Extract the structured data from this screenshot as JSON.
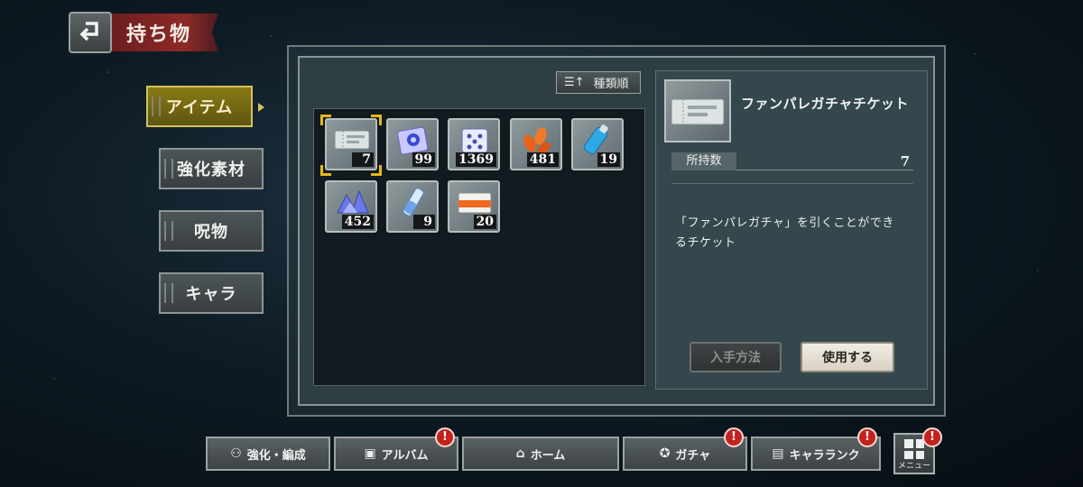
{
  "header": {
    "title": "持ち物",
    "back_icon": "return-arrow-icon"
  },
  "side_tabs": [
    {
      "label": "アイテム",
      "active": true
    },
    {
      "label": "強化素材",
      "active": false
    },
    {
      "label": "呪物",
      "active": false
    },
    {
      "label": "キャラ",
      "active": false
    }
  ],
  "sort": {
    "label": "種類順",
    "icon": "sort-icon"
  },
  "items": [
    {
      "name": "ticket",
      "count": "7",
      "selected": true
    },
    {
      "name": "crystal-card",
      "count": "99"
    },
    {
      "name": "dice-box",
      "count": "1369"
    },
    {
      "name": "orange-petals",
      "count": "481"
    },
    {
      "name": "blue-bottle",
      "count": "19"
    },
    {
      "name": "crystal-shards",
      "count": "452"
    },
    {
      "name": "vial",
      "count": "9"
    },
    {
      "name": "orange-card",
      "count": "20"
    }
  ],
  "detail": {
    "name": "ファンパレガチャチケット",
    "owned_label": "所持数",
    "owned_value": "7",
    "desc_line1": "「ファンパレガチャ」を引くことができ",
    "desc_line2": "るチケット",
    "btn_obtain": "入手方法",
    "btn_use": "使用する"
  },
  "bottom_nav": {
    "enhance": "強化・編成",
    "album": "アルバム",
    "home": "ホーム",
    "gacha": "ガチャ",
    "rank": "キャラランク",
    "menu": "メニュー",
    "badge": "!"
  },
  "colors": {
    "accent_gold": "#d4c25b",
    "title_red": "#8d2a27",
    "badge_red": "#c2231e"
  }
}
